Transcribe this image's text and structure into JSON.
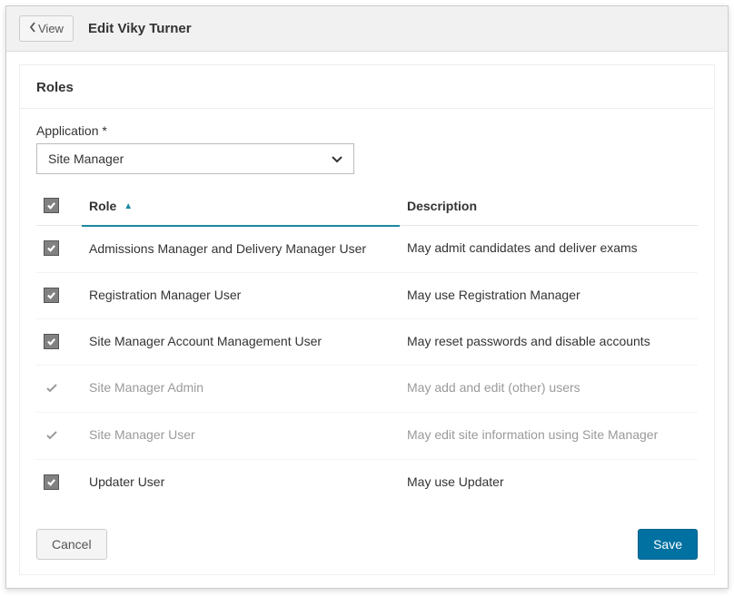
{
  "header": {
    "view_label": "View",
    "title": "Edit Viky Turner"
  },
  "panel": {
    "title": "Roles",
    "application_label": "Application *",
    "application_value": "Site Manager"
  },
  "table": {
    "role_header": "Role",
    "description_header": "Description",
    "rows": [
      {
        "role": "Admissions Manager and Delivery Manager User",
        "description": "May admit candidates and deliver exams",
        "state": "checked"
      },
      {
        "role": "Registration Manager User",
        "description": "May use Registration Manager",
        "state": "checked"
      },
      {
        "role": "Site Manager Account Management User",
        "description": "May reset passwords and disable accounts",
        "state": "checked"
      },
      {
        "role": "Site Manager Admin",
        "description": "May add and edit (other) users",
        "state": "inherited"
      },
      {
        "role": "Site Manager User",
        "description": "May edit site information using Site Manager",
        "state": "inherited"
      },
      {
        "role": "Updater User",
        "description": "May use Updater",
        "state": "checked"
      }
    ]
  },
  "footer": {
    "cancel_label": "Cancel",
    "save_label": "Save"
  }
}
